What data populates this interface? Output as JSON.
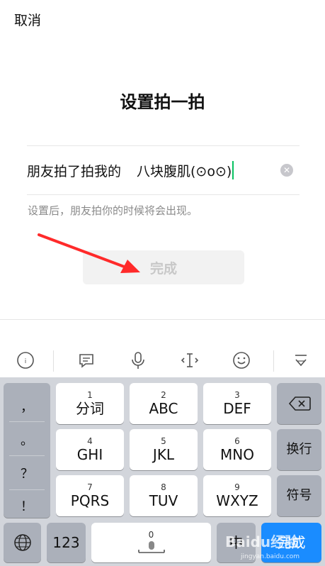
{
  "header": {
    "cancel_label": "取消",
    "title": "设置拍一拍"
  },
  "field": {
    "prefix": "朋友拍了拍我的",
    "value": "八块腹肌(⊙o⊙)"
  },
  "hint": "设置后，朋友拍你的时候将会出现。",
  "done_label": "完成",
  "toolbar": {
    "icons": [
      "keyboard-switch-icon",
      "chat-icon",
      "microphone-icon",
      "cursor-icon",
      "emoji-icon",
      "hide-keyboard-icon"
    ]
  },
  "keyboard": {
    "punctuation": [
      "，",
      "。",
      "？",
      "！"
    ],
    "rows": [
      [
        {
          "num": "1",
          "label": "分词"
        },
        {
          "num": "2",
          "label": "ABC"
        },
        {
          "num": "3",
          "label": "DEF"
        }
      ],
      [
        {
          "num": "4",
          "label": "GHI"
        },
        {
          "num": "5",
          "label": "JKL"
        },
        {
          "num": "6",
          "label": "MNO"
        }
      ],
      [
        {
          "num": "7",
          "label": "PQRS"
        },
        {
          "num": "8",
          "label": "TUV"
        },
        {
          "num": "9",
          "label": "WXYZ"
        }
      ]
    ],
    "right_keys": {
      "newline": "换行",
      "symbols": "符号"
    },
    "bottom": {
      "num_label": "123",
      "space_num": "0",
      "lang_label": "中",
      "confirm_label": "完成"
    }
  },
  "watermark": {
    "brand": "Baidu经验",
    "url": "jingyan.baidu.com"
  },
  "colors": {
    "accent_green": "#07c160",
    "confirm_blue": "#1a8cff",
    "arrow_red": "#ff2a2a"
  }
}
